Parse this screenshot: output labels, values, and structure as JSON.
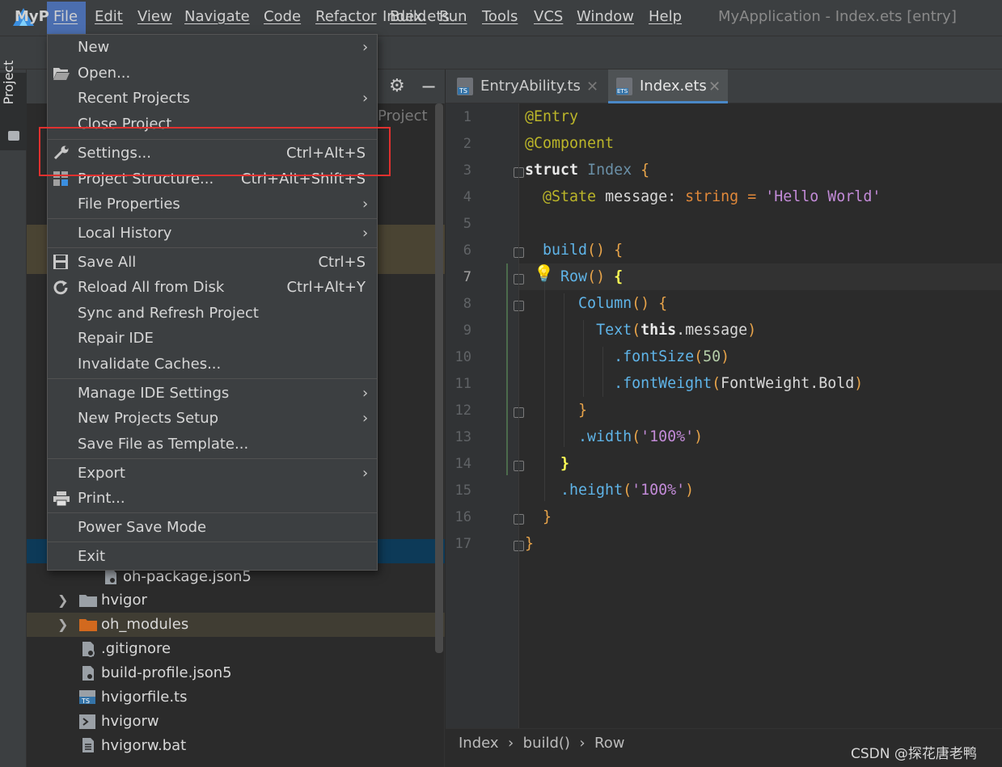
{
  "window": {
    "title": "MyApplication - Index.ets [entry]"
  },
  "menubar": {
    "items": [
      "File",
      "Edit",
      "View",
      "Navigate",
      "Code",
      "Refactor",
      "Build",
      "Run",
      "Tools",
      "VCS",
      "Window",
      "Help"
    ]
  },
  "navbar": {
    "project_short": "MyP",
    "current_file": "Index.ets"
  },
  "toolstrip": {
    "project_label": "Project"
  },
  "project_panel": {
    "scope_label": "Project",
    "tree": [
      {
        "label": "oh-package.json5",
        "icon": "json-config-icon"
      },
      {
        "label": "hvigor",
        "icon": "folder-icon",
        "expandable": true
      },
      {
        "label": "oh_modules",
        "icon": "folder-orange-icon",
        "expandable": true
      },
      {
        "label": ".gitignore",
        "icon": "gitignore-file-icon"
      },
      {
        "label": "build-profile.json5",
        "icon": "json-config-icon"
      },
      {
        "label": "hvigorfile.ts",
        "icon": "ts-file-icon"
      },
      {
        "label": "hvigorw",
        "icon": "shell-script-icon"
      },
      {
        "label": "hvigorw.bat",
        "icon": "bat-file-icon"
      }
    ]
  },
  "file_menu": {
    "items": {
      "new": {
        "label": "New"
      },
      "open": {
        "label": "Open..."
      },
      "recent": {
        "label": "Recent Projects"
      },
      "close": {
        "label": "Close Project"
      },
      "settings": {
        "label": "Settings...",
        "shortcut": "Ctrl+Alt+S"
      },
      "structure": {
        "label": "Project Structure...",
        "shortcut": "Ctrl+Alt+Shift+S"
      },
      "file_props": {
        "label": "File Properties"
      },
      "local_history": {
        "label": "Local History"
      },
      "save_all": {
        "label": "Save All",
        "shortcut": "Ctrl+S"
      },
      "reload": {
        "label": "Reload All from Disk",
        "shortcut": "Ctrl+Alt+Y"
      },
      "sync": {
        "label": "Sync and Refresh Project"
      },
      "repair": {
        "label": "Repair IDE"
      },
      "invalidate": {
        "label": "Invalidate Caches..."
      },
      "manage_ide": {
        "label": "Manage IDE Settings"
      },
      "new_proj_setup": {
        "label": "New Projects Setup"
      },
      "save_template": {
        "label": "Save File as Template..."
      },
      "export": {
        "label": "Export"
      },
      "print": {
        "label": "Print..."
      },
      "power_save": {
        "label": "Power Save Mode"
      },
      "exit": {
        "label": "Exit"
      }
    },
    "highlighted_item": "Settings...",
    "highlight_color": "#e0312f"
  },
  "editor": {
    "tabs": [
      {
        "label": "EntryAbility.ts",
        "badge": "TS",
        "active": false
      },
      {
        "label": "Index.ets",
        "badge": "ETS",
        "active": true
      }
    ],
    "line_numbers": [
      "1",
      "2",
      "3",
      "4",
      "5",
      "6",
      "7",
      "8",
      "9",
      "10",
      "11",
      "12",
      "13",
      "14",
      "15",
      "16",
      "17"
    ],
    "current_line": 7,
    "breadcrumb": "Index  ›  build()  ›  Row"
  },
  "watermark": "CSDN @探花唐老鸭"
}
